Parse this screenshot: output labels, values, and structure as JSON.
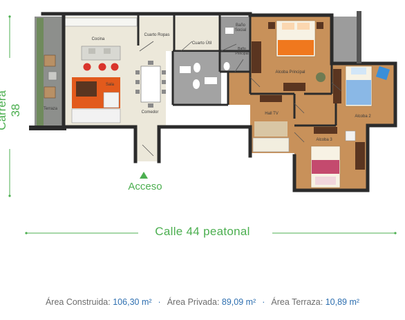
{
  "streets": {
    "left": "Carrera 38",
    "bottom": "Calle 44 peatonal"
  },
  "entrance_label": "Acceso",
  "rooms": {
    "cocina": "Cocina",
    "cuarto_ropas": "Cuarto Ropas",
    "cuarto_util": "Cuarto Útil",
    "bano_social_1": "Baño",
    "bano_social_2": "Social",
    "bano_ppal_1": "Baño",
    "bano_ppal_2": "Principal",
    "sala": "Sala",
    "terraza": "Terraza",
    "comedor": "Comedor",
    "alcoba_principal": "Alcoba Principal",
    "hall_tv": "Hall TV",
    "alcoba_2": "Alcoba 2",
    "alcoba_3": "Alcoba 3"
  },
  "areas": [
    {
      "label": "Área Construida:",
      "value": "106,30 m²"
    },
    {
      "label": "Área Privada:",
      "value": "89,09 m²"
    },
    {
      "label": "Área Terraza:",
      "value": "10,89 m²"
    }
  ],
  "separator": "·",
  "colors": {
    "accent_green": "#4caf50",
    "area_value_blue": "#2e6fb0",
    "wall": "#2b2b2b",
    "wood_floor": "#c8915a",
    "tile_floor": "#ece8da",
    "bath_floor": "#9a9a9a"
  }
}
